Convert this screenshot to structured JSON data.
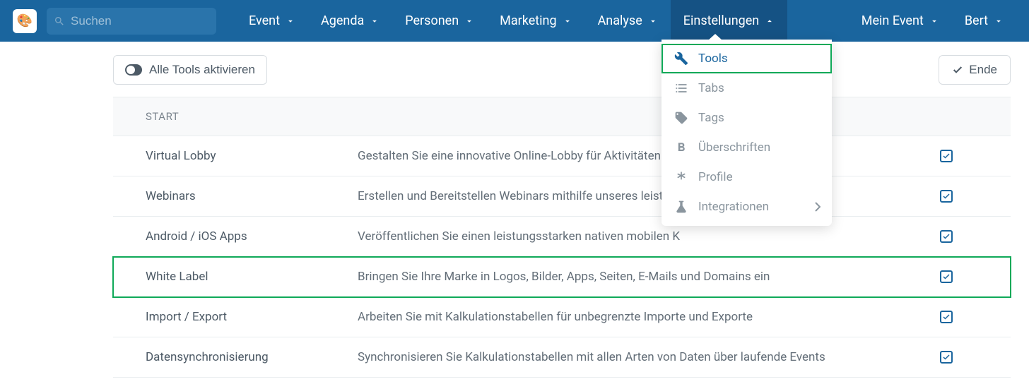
{
  "search": {
    "placeholder": "Suchen"
  },
  "nav": {
    "items": [
      {
        "label": "Event"
      },
      {
        "label": "Agenda"
      },
      {
        "label": "Personen"
      },
      {
        "label": "Marketing"
      },
      {
        "label": "Analyse"
      },
      {
        "label": "Einstellungen"
      }
    ],
    "right": [
      {
        "label": "Mein Event"
      },
      {
        "label": "Bert"
      }
    ]
  },
  "dropdown": {
    "items": [
      {
        "label": "Tools"
      },
      {
        "label": "Tabs"
      },
      {
        "label": "Tags"
      },
      {
        "label": "Überschriften"
      },
      {
        "label": "Profile"
      },
      {
        "label": "Integrationen"
      }
    ]
  },
  "header": {
    "toggle_label": "Alle Tools aktivieren",
    "end_label": "Ende"
  },
  "section": {
    "title": "START"
  },
  "tools": [
    {
      "name": "Virtual Lobby",
      "desc": "Gestalten Sie eine innovative Online-Lobby für Aktivitäten u"
    },
    {
      "name": "Webinars",
      "desc": "Erstellen und Bereitstellen Webinars mithilfe unseres leistu"
    },
    {
      "name": "Android / iOS Apps",
      "desc": "Veröffentlichen Sie einen leistungsstarken nativen mobilen K"
    },
    {
      "name": "White Label",
      "desc": "Bringen Sie Ihre Marke in Logos, Bilder, Apps, Seiten, E-Mails und Domains ein"
    },
    {
      "name": "Import / Export",
      "desc": "Arbeiten Sie mit Kalkulationstabellen für unbegrenzte Importe und Exporte"
    },
    {
      "name": "Datensynchronisierung",
      "desc": "Synchronisieren Sie Kalkulationstabellen mit allen Arten von Daten über laufende Events"
    }
  ]
}
